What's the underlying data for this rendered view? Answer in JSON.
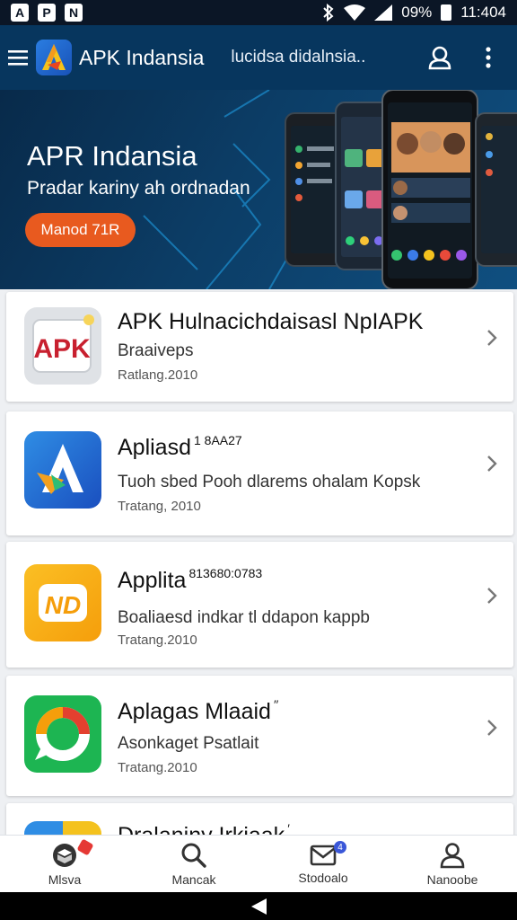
{
  "status_bar": {
    "left_icons": [
      "A",
      "P",
      "N"
    ],
    "battery_percent": "09%",
    "time": "11:404"
  },
  "appbar": {
    "title": "APK Indansia",
    "subtitle": "lucidsa didalnsia.."
  },
  "hero": {
    "title": "APR Indansia",
    "subtitle": "Pradar kariny ah ordnadan",
    "button_label": "Manod 71R"
  },
  "apps": [
    {
      "name": "APK Hulnacichdaisasl NpIAPK",
      "name_sup": "",
      "desc": "Braaiveps",
      "date": "Ratlang.2010",
      "icon": "apk-logo-icon"
    },
    {
      "name": "Apliasd",
      "name_sup": "1 8AA27",
      "desc": "Tuoh sbed Pooh dlarems ohalam  Kopsk",
      "date": "Tratang, 2010",
      "icon": "blue-a-logo-icon"
    },
    {
      "name": "Applita",
      "name_sup": "813680:0783",
      "desc": "Boaliaesd indkar tl ddapon kappb",
      "date": "Tratang.2010",
      "icon": "orange-nd-logo-icon"
    },
    {
      "name": "Aplagas Mlaaid",
      "name_sup": "′′",
      "desc": "Asonkaget Psatlait",
      "date": "Tratang.2010",
      "icon": "green-ring-logo-icon"
    },
    {
      "name": "Dralaniny Irkiaak",
      "name_sup": "′",
      "desc": "",
      "date": "",
      "icon": "blue-yellow-logo-icon"
    }
  ],
  "bottom_nav": [
    {
      "label": "Mlsva",
      "icon": "box-icon",
      "badge": "red"
    },
    {
      "label": "Mancak",
      "icon": "search-icon",
      "badge": ""
    },
    {
      "label": "Stodoalo",
      "icon": "mail-icon",
      "badge": "4"
    },
    {
      "label": "Nanoobe",
      "icon": "person-icon",
      "badge": ""
    }
  ],
  "colors": {
    "appbar": "#07365e",
    "hero_button": "#e85a1f",
    "accent_blue": "#3a57d8"
  }
}
